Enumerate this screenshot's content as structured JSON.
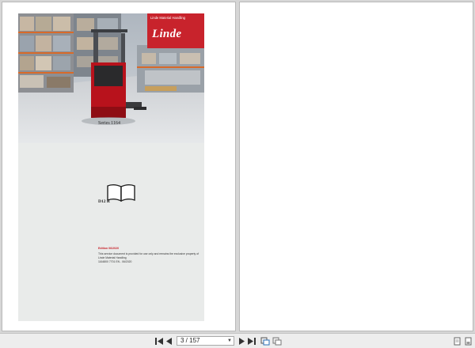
{
  "cover": {
    "brand_tagline": "Linde Material Handling",
    "brand_logo": "Linde",
    "series": "Series 1164",
    "doc_code": "D12 R",
    "edition": "Edition 06/2020",
    "fine_print": [
      "This service document is provided for use only and remains the exclusive property of",
      "Linde Material Handling",
      "1164800 7701 EN - 06/2020"
    ],
    "accent_color": "#c8232c",
    "icon": "book-icon"
  },
  "toolbar": {
    "page_indicator": "3 / 157",
    "buttons": [
      {
        "name": "first-page-button",
        "icon": "skip-first-icon"
      },
      {
        "name": "previous-page-button",
        "icon": "triangle-left-icon"
      },
      {
        "name": "next-page-button",
        "icon": "triangle-right-icon"
      },
      {
        "name": "last-page-button",
        "icon": "skip-last-icon"
      },
      {
        "name": "fit-width-button",
        "icon": "fit-icon"
      },
      {
        "name": "two-page-button",
        "icon": "pages-icon"
      },
      {
        "name": "single-page-view-button",
        "icon": "single-page-icon"
      },
      {
        "name": "page-thumbnail-button",
        "icon": "bookmark-page-icon"
      }
    ]
  }
}
